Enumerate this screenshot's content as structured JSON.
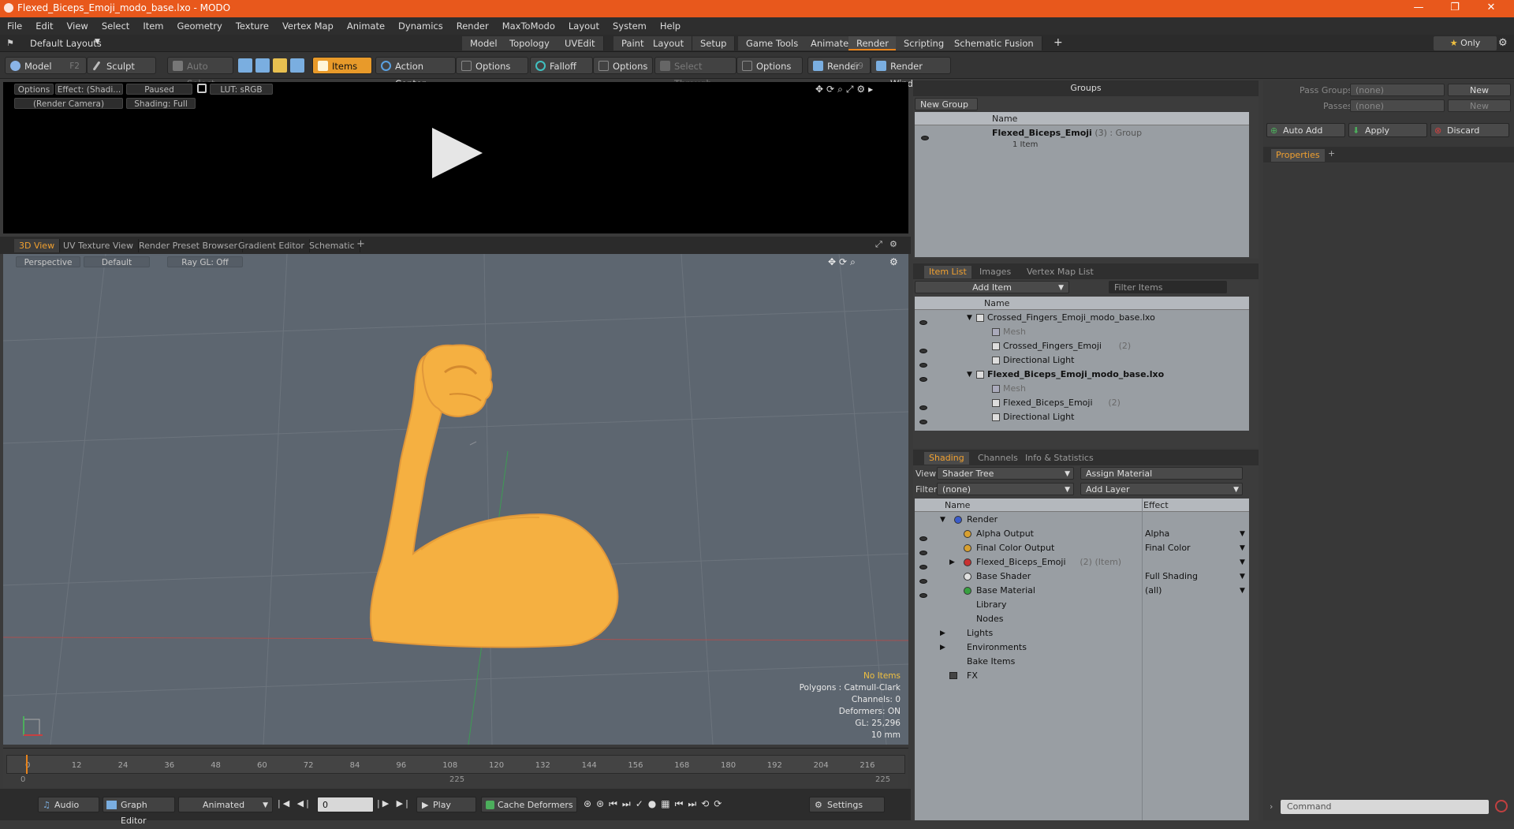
{
  "window": {
    "title": "Flexed_Biceps_Emoji_modo_base.lxo - MODO",
    "minimize": "—",
    "maximize": "❐",
    "close": "✕"
  },
  "menu": [
    "File",
    "Edit",
    "View",
    "Select",
    "Item",
    "Geometry",
    "Texture",
    "Vertex Map",
    "Animate",
    "Dynamics",
    "Render",
    "MaxToModo",
    "Layout",
    "System",
    "Help"
  ],
  "layouts": {
    "selector": "Default Layouts",
    "tabs": [
      "Model",
      "Topology",
      "UVEdit",
      "Paint",
      "Layout",
      "Setup",
      "Game Tools",
      "Animate",
      "Render",
      "Scripting",
      "Schematic Fusion"
    ],
    "active": "Render",
    "only": "Only"
  },
  "toolbar": {
    "model": "Model",
    "model_key": "F2",
    "sculpt": "Sculpt",
    "auto_select": "Auto Select",
    "items": "Items",
    "action_center": "Action Center",
    "options1": "Options",
    "falloff": "Falloff",
    "options2": "Options",
    "select_through": "Select Through",
    "options3": "Options",
    "render": "Render",
    "render_key": "F9",
    "render_window": "Render Window"
  },
  "render_view": {
    "options": "Options",
    "effect": "Effect: (Shadi...",
    "paused": "Paused",
    "lut": "LUT: sRGB",
    "camera": "(Render Camera)",
    "shading": "Shading: Full"
  },
  "view_tabs": [
    "3D View",
    "UV Texture View",
    "Render Preset Browser",
    "Gradient Editor",
    "Schematic"
  ],
  "viewport": {
    "perspective": "Perspective",
    "default": "Default",
    "raygl": "Ray GL: Off"
  },
  "stats": {
    "no_items": "No Items",
    "polygons": "Polygons : Catmull-Clark",
    "channels": "Channels: 0",
    "deformers": "Deformers: ON",
    "gl": "GL: 25,296",
    "scale": "10 mm"
  },
  "timeline": {
    "ticks": [
      "0",
      "12",
      "24",
      "36",
      "48",
      "60",
      "72",
      "84",
      "96",
      "108",
      "120",
      "132",
      "144",
      "156",
      "168",
      "180",
      "192",
      "204",
      "216"
    ],
    "start": "0",
    "end": "225",
    "mid": "225"
  },
  "bottom": {
    "audio": "Audio",
    "graph_editor": "Graph Editor",
    "animated": "Animated",
    "frame": "0",
    "play": "Play",
    "cache": "Cache Deformers",
    "settings": "Settings"
  },
  "groups": {
    "title": "Groups",
    "new_group": "New Group",
    "col_name": "Name",
    "item_name": "Flexed_Biceps_Emoji",
    "item_count": "(3)",
    "item_type": ": Group",
    "item_sub": "1 Item"
  },
  "passes": {
    "pass_groups": "Pass Groups",
    "passes": "Passes",
    "none1": "(none)",
    "none2": "(none)",
    "new1": "New",
    "new2": "New",
    "auto_add": "Auto Add",
    "apply": "Apply",
    "discard": "Discard",
    "properties": "Properties"
  },
  "item_list": {
    "tabs": [
      "Item List",
      "Images",
      "Vertex Map List"
    ],
    "add_item": "Add Item",
    "filter": "Filter Items",
    "col_name": "Name",
    "rows": [
      {
        "text": "Crossed_Fingers_Emoji_modo_base.lxo",
        "suffix": "",
        "indent": 0,
        "bold": false,
        "muted": false
      },
      {
        "text": "Mesh",
        "suffix": "",
        "indent": 1,
        "bold": false,
        "muted": true
      },
      {
        "text": "Crossed_Fingers_Emoji",
        "suffix": "(2)",
        "indent": 1,
        "bold": false,
        "muted": false
      },
      {
        "text": "Directional Light",
        "suffix": "",
        "indent": 1,
        "bold": false,
        "muted": false
      },
      {
        "text": "Flexed_Biceps_Emoji_modo_base.lxo",
        "suffix": "",
        "indent": 0,
        "bold": true,
        "muted": false
      },
      {
        "text": "Mesh",
        "suffix": "",
        "indent": 1,
        "bold": false,
        "muted": true
      },
      {
        "text": "Flexed_Biceps_Emoji",
        "suffix": "(2)",
        "indent": 1,
        "bold": false,
        "muted": false
      },
      {
        "text": "Directional Light",
        "suffix": "",
        "indent": 1,
        "bold": false,
        "muted": false
      }
    ]
  },
  "shading": {
    "tabs": [
      "Shading",
      "Channels",
      "Info & Statistics"
    ],
    "view_label": "View",
    "view_value": "Shader Tree",
    "assign": "Assign Material",
    "filter_label": "Filter",
    "filter_value": "(none)",
    "add_layer": "Add Layer",
    "col_name": "Name",
    "col_effect": "Effect",
    "rows": [
      {
        "text": "Render",
        "suffix": "",
        "effect": "",
        "indent": 0,
        "color": "#3b5cc9"
      },
      {
        "text": "Alpha Output",
        "suffix": "",
        "effect": "Alpha",
        "indent": 1,
        "color": "#d8a030"
      },
      {
        "text": "Final Color Output",
        "suffix": "",
        "effect": "Final Color",
        "indent": 1,
        "color": "#d8a030"
      },
      {
        "text": "Flexed_Biceps_Emoji",
        "suffix": "(2) (Item)",
        "effect": "",
        "indent": 1,
        "color": "#c83030"
      },
      {
        "text": "Base Shader",
        "suffix": "",
        "effect": "Full Shading",
        "indent": 1,
        "color": "#e0e0e0"
      },
      {
        "text": "Base Material",
        "suffix": "",
        "effect": "(all)",
        "indent": 1,
        "color": "#38a040"
      },
      {
        "text": "Library",
        "suffix": "",
        "effect": "",
        "indent": 1,
        "color": ""
      },
      {
        "text": "Nodes",
        "suffix": "",
        "effect": "",
        "indent": 1,
        "color": ""
      },
      {
        "text": "Lights",
        "suffix": "",
        "effect": "",
        "indent": 0,
        "color": ""
      },
      {
        "text": "Environments",
        "suffix": "",
        "effect": "",
        "indent": 0,
        "color": ""
      },
      {
        "text": "Bake Items",
        "suffix": "",
        "effect": "",
        "indent": 0,
        "color": ""
      },
      {
        "text": "FX",
        "suffix": "",
        "effect": "",
        "indent": 0,
        "color": ""
      }
    ]
  },
  "command": {
    "placeholder": "Command"
  },
  "colors": {
    "accent": "#e8581c",
    "orange": "#f0a030",
    "biceps": "#f5b041"
  }
}
